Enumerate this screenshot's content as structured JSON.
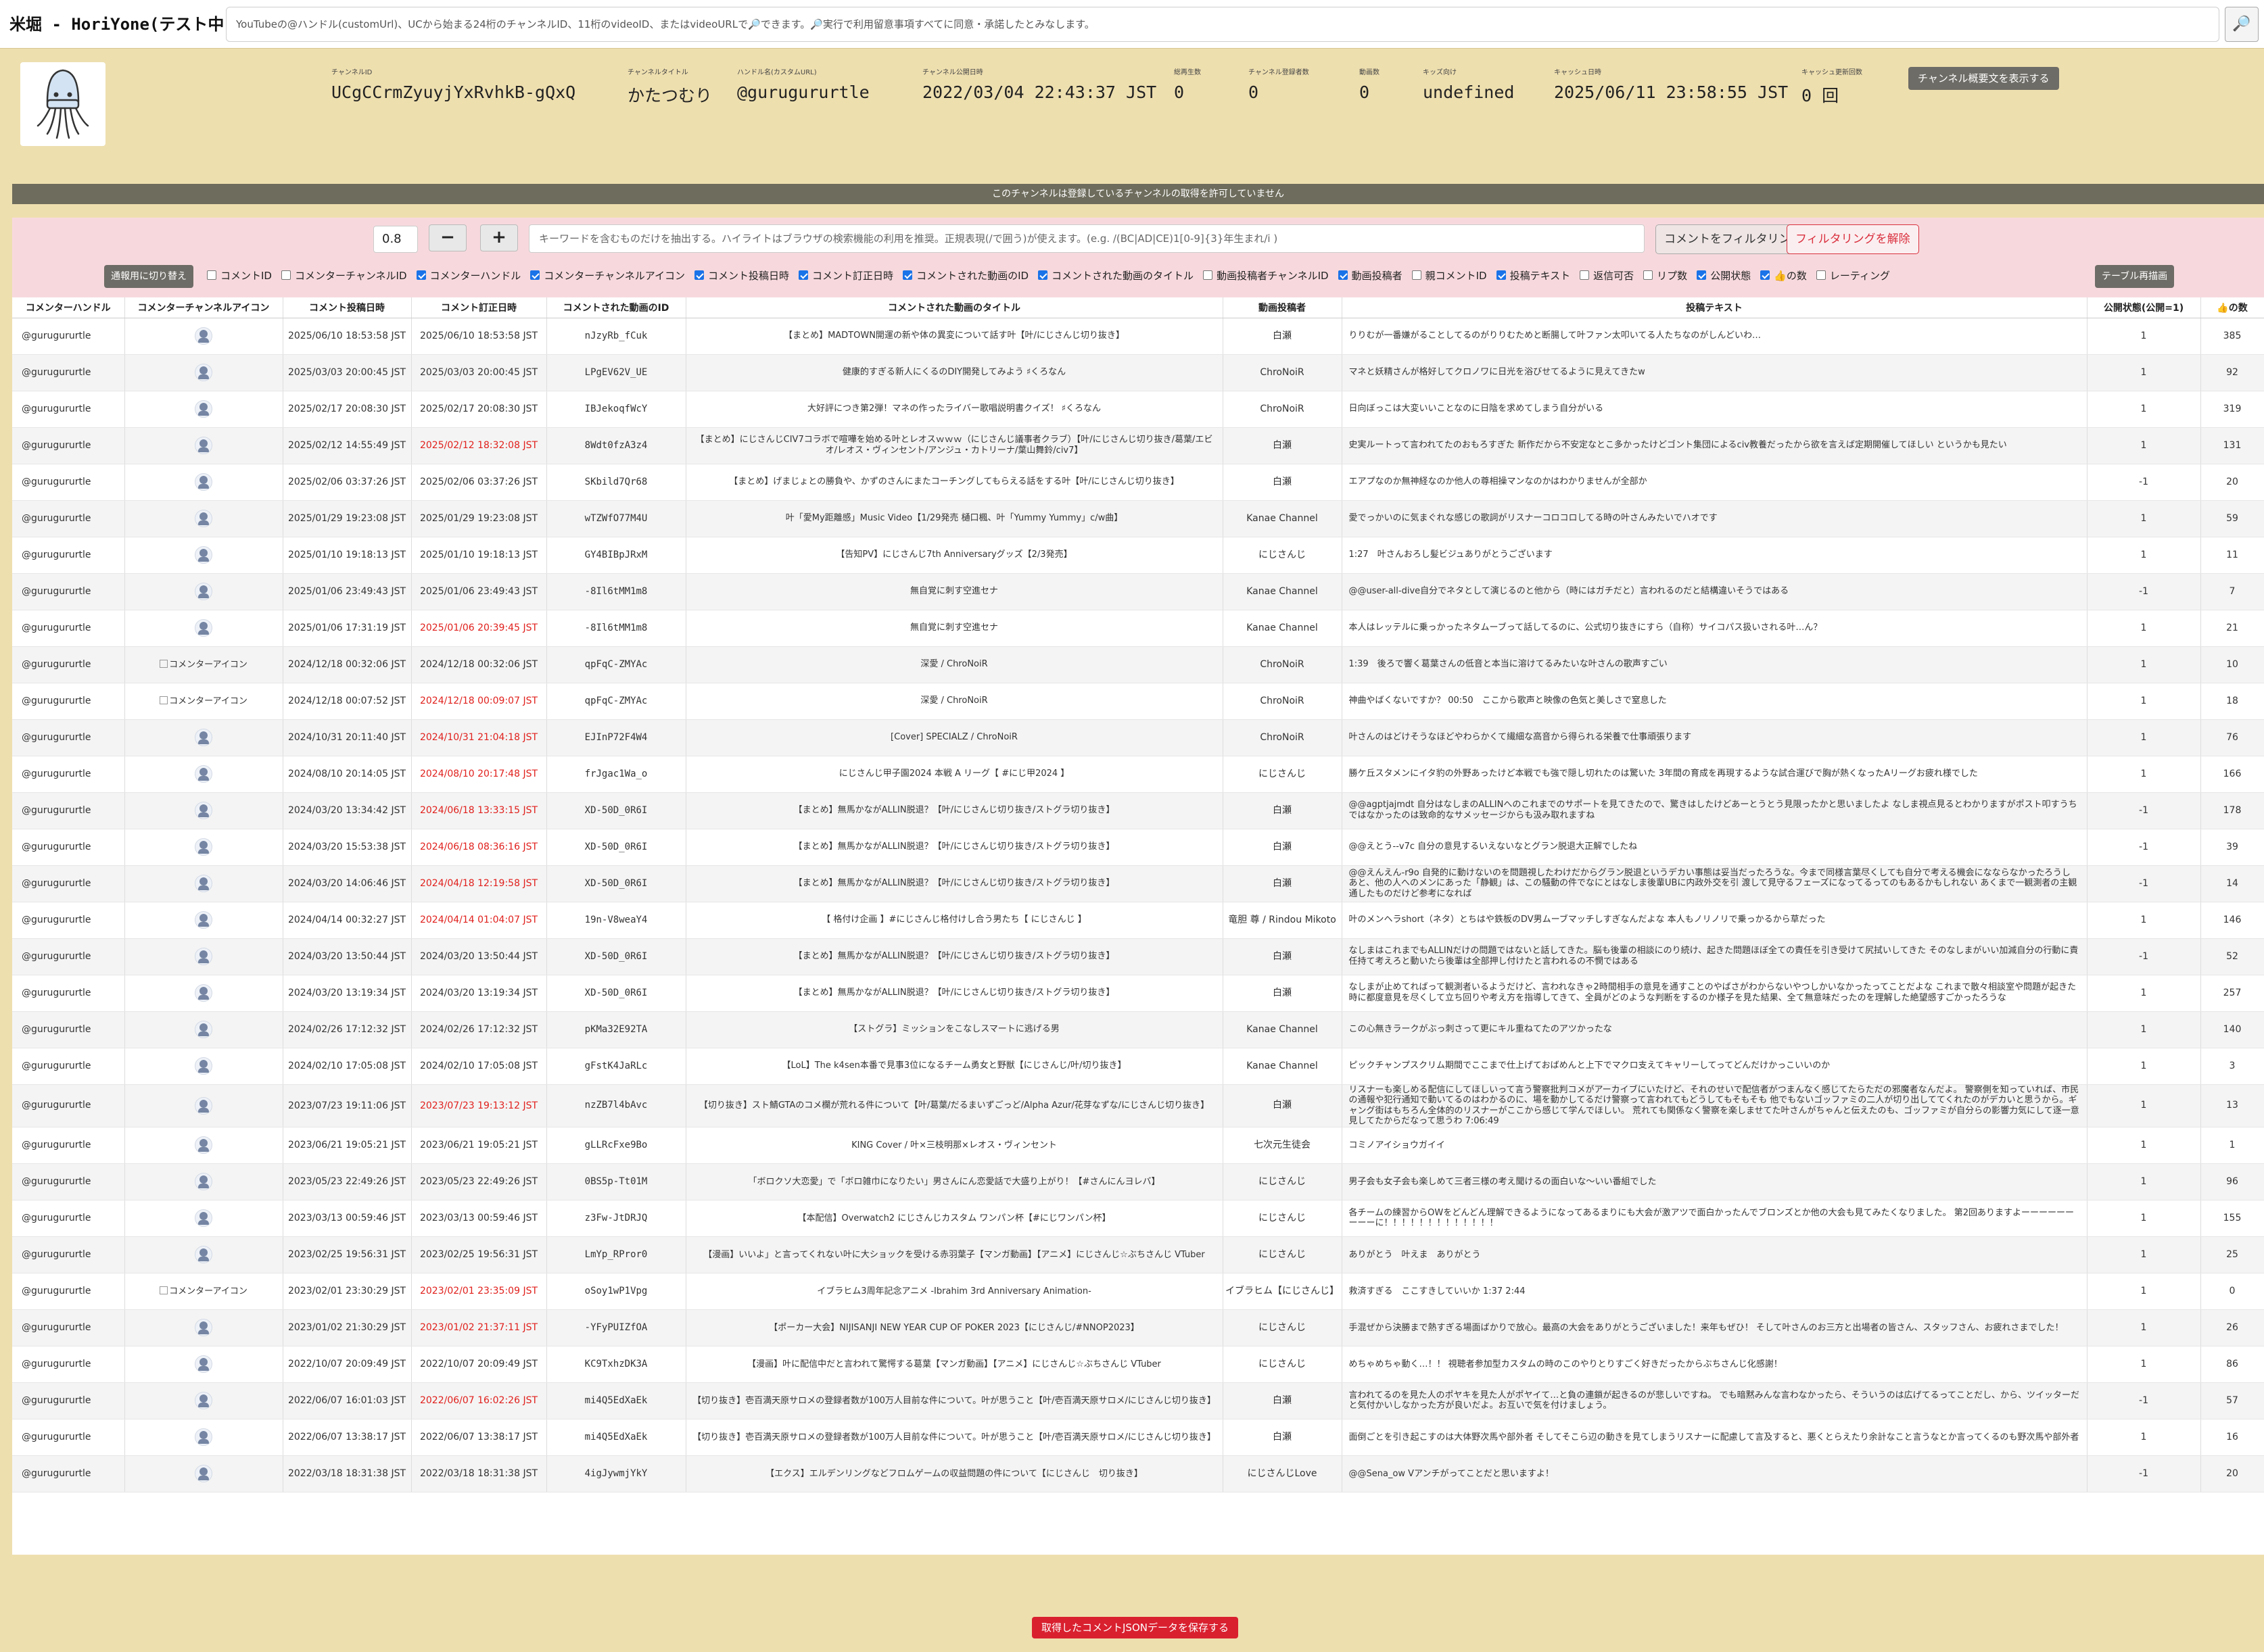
{
  "app": {
    "title": "米堀 - HoriYone(テスト中)",
    "search_placeholder": "YouTubeの@ハンドル(customUrl)、UCから始まる24桁のチャンネルID、11桁のvideoID、またはvideoURLで🔎できます。🔎実行で利用留意事項すべてに同意・承諾したとみなします。",
    "search_icon": "🔎"
  },
  "channel": {
    "fields": [
      {
        "label": "チャンネルID",
        "value": "UCgCCrmZyuyjYxRvhkB-gQxQ"
      },
      {
        "label": "チャンネルタイトル",
        "value": "かたつむり"
      },
      {
        "label": "ハンドル名(カスタムURL)",
        "value": "@gurugururtle"
      },
      {
        "label": "チャンネル公開日時",
        "value": "2022/03/04 22:43:37 JST"
      },
      {
        "label": "総再生数",
        "value": "0"
      },
      {
        "label": "チャンネル登録者数",
        "value": "0"
      },
      {
        "label": "動画数",
        "value": "0"
      },
      {
        "label": "キッズ向け",
        "value": "undefined"
      },
      {
        "label": "キャッシュ日時",
        "value": "2025/06/11 23:58:55 JST"
      },
      {
        "label": "キャッシュ更新回数",
        "value": "0 回"
      }
    ],
    "show_desc_label": "チャンネル概要文を表示する"
  },
  "notice": "このチャンネルは登録しているチャンネルの取得を許可していません",
  "filter": {
    "threshold": "0.8",
    "minus": "−",
    "plus": "+",
    "keyword_placeholder": "キーワードを含むものだけを抽出する。ハイライトはブラウザの検索機能の利用を推奨。正規表現(/で囲う)が使えます。(e.g. /(BC|AD|CE)1[0-9]{3}年生まれ/i )",
    "apply_label": "コメントをフィルタリング",
    "clear_label": "フィルタリングを解除"
  },
  "toggle_label": "通報用に切り替え",
  "redraw_label": "テーブル再描画",
  "columns_toggle": [
    {
      "label": "コメントID",
      "checked": false
    },
    {
      "label": "コメンターチャンネルID",
      "checked": false
    },
    {
      "label": "コメンターハンドル",
      "checked": true
    },
    {
      "label": "コメンターチャンネルアイコン",
      "checked": true
    },
    {
      "label": "コメント投稿日時",
      "checked": true
    },
    {
      "label": "コメント訂正日時",
      "checked": true
    },
    {
      "label": "コメントされた動画のID",
      "checked": true
    },
    {
      "label": "コメントされた動画のタイトル",
      "checked": true
    },
    {
      "label": "動画投稿者チャンネルID",
      "checked": false
    },
    {
      "label": "動画投稿者",
      "checked": true
    },
    {
      "label": "親コメントID",
      "checked": false
    },
    {
      "label": "投稿テキスト",
      "checked": true
    },
    {
      "label": "返信可否",
      "checked": false
    },
    {
      "label": "リプ数",
      "checked": false
    },
    {
      "label": "公開状態",
      "checked": true
    },
    {
      "label": "👍の数",
      "checked": true
    },
    {
      "label": "レーティング",
      "checked": false
    }
  ],
  "table": {
    "headers": [
      "コメンターハンドル",
      "コメンターチャンネルアイコン",
      "コメント投稿日時",
      "コメント訂正日時",
      "コメントされた動画のID",
      "コメントされた動画のタイトル",
      "動画投稿者",
      "投稿テキスト",
      "公開状態(公開=1)",
      "👍の数"
    ],
    "icon_alt": "コメンターアイコン",
    "rows": [
      {
        "handle": "@gurugururtle",
        "icon": "avatar",
        "posted": "2025/06/10 18:53:58 JST",
        "edited": "2025/06/10 18:53:58 JST",
        "edited_diff": false,
        "video_id": "nJzyRb_fCuk",
        "title": "【まとめ】MADTOWN開運の新や体の異変について話す叶【叶/にじさんじ切り抜き】",
        "uploader": "白瀬",
        "text": "りりむが一番嫌がることしてるのがりりむためと断腸して叶ファン太叩いてる人たちなのがしんどいわ…",
        "status": "1",
        "likes": "385"
      },
      {
        "handle": "@gurugururtle",
        "icon": "avatar",
        "posted": "2025/03/03 20:00:45 JST",
        "edited": "2025/03/03 20:00:45 JST",
        "edited_diff": false,
        "video_id": "LPgEV62V_UE",
        "title": "健康的すぎる新人にくるのDIY開発してみよう ♯くろなん",
        "uploader": "ChroNoiR",
        "text": "マネと妖精さんが格好してクロノワに日光を浴びせてるように見えてきたw",
        "status": "1",
        "likes": "92"
      },
      {
        "handle": "@gurugururtle",
        "icon": "avatar",
        "posted": "2025/02/17 20:08:30 JST",
        "edited": "2025/02/17 20:08:30 JST",
        "edited_diff": false,
        "video_id": "IBJekoqfWcY",
        "title": "大好評につき第2弾！マネの作ったライバー歌唱説明書クイズ！ ♯くろなん",
        "uploader": "ChroNoiR",
        "text": "日向ぼっこは大変いいことなのに日陰を求めてしまう自分がいる",
        "status": "1",
        "likes": "319"
      },
      {
        "handle": "@gurugururtle",
        "icon": "avatar",
        "posted": "2025/02/12 14:55:49 JST",
        "edited": "2025/02/12 18:32:08 JST",
        "edited_diff": true,
        "video_id": "8Wdt0fzA3z4",
        "title": "【まとめ】にじさんじCIV7コラボで喧嘩を始める叶とレオスｗｗｗ（にじさんじ議事者クラブ）【叶/にじさんじ切り抜き/葛葉/エビオ/レオス・ヴィンセント/アンジュ・カトリーナ/葉山舞鈴/civ7】",
        "uploader": "白瀬",
        "text": "史実ルートって言われてたのおもろすぎた 新作だから不安定なとこ多かったけどゴント集団によるciv教養だったから欲を言えば定期開催してほしい というかも見たい",
        "status": "1",
        "likes": "131"
      },
      {
        "handle": "@gurugururtle",
        "icon": "avatar",
        "posted": "2025/02/06 03:37:26 JST",
        "edited": "2025/02/06 03:37:26 JST",
        "edited_diff": false,
        "video_id": "SKbild7Qr68",
        "title": "【まとめ】げまじょとの勝負や、かずのさんにまたコーチングしてもらえる話をする叶【叶/にじさんじ切り抜き】",
        "uploader": "白瀬",
        "text": "エアプなのか無神経なのか他人の尊相操マンなのかはわかりませんが全部か",
        "status": "-1",
        "likes": "20"
      },
      {
        "handle": "@gurugururtle",
        "icon": "avatar",
        "posted": "2025/01/29 19:23:08 JST",
        "edited": "2025/01/29 19:23:08 JST",
        "edited_diff": false,
        "video_id": "wTZWfO77M4U",
        "title": "叶「愛My距離感」Music Video【1/29発売 樋口楓、叶「Yummy Yummy」c/w曲】",
        "uploader": "Kanae Channel",
        "text": "愛でっかいのに気まぐれな感じの歌詞がリスナーコロコロしてる時の叶さんみたいでハオです",
        "status": "1",
        "likes": "59"
      },
      {
        "handle": "@gurugururtle",
        "icon": "avatar",
        "posted": "2025/01/10 19:18:13 JST",
        "edited": "2025/01/10 19:18:13 JST",
        "edited_diff": false,
        "video_id": "GY4BIBpJRxM",
        "title": "【告知PV】にじさんじ7th Anniversaryグッズ【2/3発売】",
        "uploader": "にじさんじ",
        "text": "1:27　叶さんおろし髪ビジュありがとうございます",
        "status": "1",
        "likes": "11"
      },
      {
        "handle": "@gurugururtle",
        "icon": "avatar",
        "posted": "2025/01/06 23:49:43 JST",
        "edited": "2025/01/06 23:49:43 JST",
        "edited_diff": false,
        "video_id": "-8Il6tMM1m8",
        "title": "無自覚に刺す空進セナ",
        "uploader": "Kanae Channel",
        "text": "@@user-all-dive自分でネタとして演じるのと他から（時にはガチだと）言われるのだと結構違いそうではある",
        "status": "-1",
        "likes": "7"
      },
      {
        "handle": "@gurugururtle",
        "icon": "avatar",
        "posted": "2025/01/06 17:31:19 JST",
        "edited": "2025/01/06 20:39:45 JST",
        "edited_diff": true,
        "video_id": "-8Il6tMM1m8",
        "title": "無自覚に刺す空進セナ",
        "uploader": "Kanae Channel",
        "text": "本人はレッテルに乗っかったネタムーブって話してるのに、公式切り抜きにすら（自称）サイコパス扱いされる叶…ん？",
        "status": "1",
        "likes": "21"
      },
      {
        "handle": "@gurugururtle",
        "icon": "broken",
        "posted": "2024/12/18 00:32:06 JST",
        "edited": "2024/12/18 00:32:06 JST",
        "edited_diff": false,
        "video_id": "qpFqC-ZMYAc",
        "title": "深愛 / ChroNoiR",
        "uploader": "ChroNoiR",
        "text": "1:39　後ろで響く葛葉さんの低音と本当に溶けてるみたいな叶さんの歌声すごい",
        "status": "1",
        "likes": "10"
      },
      {
        "handle": "@gurugururtle",
        "icon": "broken",
        "posted": "2024/12/18 00:07:52 JST",
        "edited": "2024/12/18 00:09:07 JST",
        "edited_diff": true,
        "video_id": "qpFqC-ZMYAc",
        "title": "深愛 / ChroNoiR",
        "uploader": "ChroNoiR",
        "text": "神曲やばくないですか？ 00:50　ここから歌声と映像の色気と美しさで窒息した",
        "status": "1",
        "likes": "18"
      },
      {
        "handle": "@gurugururtle",
        "icon": "avatar",
        "posted": "2024/10/31 20:11:40 JST",
        "edited": "2024/10/31 21:04:18 JST",
        "edited_diff": true,
        "video_id": "EJInP72F4W4",
        "title": "[Cover] SPECIALZ / ChroNoiR",
        "uploader": "ChroNoiR",
        "text": "叶さんのはどけそうなほどやわらかくて繊細な高音から得られる栄養で仕事頑張ります",
        "status": "1",
        "likes": "76"
      },
      {
        "handle": "@gurugururtle",
        "icon": "avatar",
        "posted": "2024/08/10 20:14:05 JST",
        "edited": "2024/08/10 20:17:48 JST",
        "edited_diff": true,
        "video_id": "frJgac1Wa_o",
        "title": "にじさんじ甲子園2024 本戦 A リーグ【 #にじ甲2024 】",
        "uploader": "にじさんじ",
        "text": "勝ケ丘スタメンにイタ豹の外野あったけど本戦でも強で隠し切れたのは驚いた 3年間の育成を再現するような試合運びで胸が熱くなったAリーグお疲れ様でした",
        "status": "1",
        "likes": "166"
      },
      {
        "handle": "@gurugururtle",
        "icon": "avatar",
        "posted": "2024/03/20 13:34:42 JST",
        "edited": "2024/06/18 13:33:15 JST",
        "edited_diff": true,
        "video_id": "XD-50D_0R6I",
        "title": "【まとめ】無馬かながALLIN脱退？【叶/にじさんじ切り抜き/ストグラ切り抜き】",
        "uploader": "白瀬",
        "text": "@@agptjajmdt 自分はなしまのALLINへのこれまでのサポートを見てきたので、驚きはしたけどあーとうとう見限ったかと思いましたよ なしま視点見るとわかりますがポスト叩すうちではなかったのは致命的なサメッセージからも汲み取れますね",
        "status": "-1",
        "likes": "178"
      },
      {
        "handle": "@gurugururtle",
        "icon": "avatar",
        "posted": "2024/03/20 15:53:38 JST",
        "edited": "2024/06/18 08:36:16 JST",
        "edited_diff": true,
        "video_id": "XD-50D_0R6I",
        "title": "【まとめ】無馬かながALLIN脱退？【叶/にじさんじ切り抜き/ストグラ切り抜き】",
        "uploader": "白瀬",
        "text": "@@えとう--v7c 自分の意見するいえないなとグラン脱退大正解でしたね",
        "status": "-1",
        "likes": "39"
      },
      {
        "handle": "@gurugururtle",
        "icon": "avatar",
        "posted": "2024/03/20 14:06:46 JST",
        "edited": "2024/04/18 12:19:58 JST",
        "edited_diff": true,
        "video_id": "XD-50D_0R6I",
        "title": "【まとめ】無馬かながALLIN脱退？【叶/にじさんじ切り抜き/ストグラ切り抜き】",
        "uploader": "白瀬",
        "text": "@@えんえん-r9o 自発的に動けないのを問題視したわけだからグラン脱退というデカい事態は妥当だったろうな。今まで同様言葉尽くしても自分で考える機会になならなかったろうし あと、他の人へのメンにあった「静観」は、この騒動の件でなにとはなしま後輩UBに内政外交を引 渡して見守るフェーズになってるってのもあるかもしれない あくまで一観測者の主観通したものだけど参考になれば",
        "status": "-1",
        "likes": "14"
      },
      {
        "handle": "@gurugururtle",
        "icon": "avatar",
        "posted": "2024/04/14 00:32:27 JST",
        "edited": "2024/04/14 01:04:07 JST",
        "edited_diff": true,
        "video_id": "19n-V8weaY4",
        "title": "【 格付け企画 】#にじさんじ格付けし合う男たち【 にじさんじ 】",
        "uploader": "竜胆 尊 / Rindou Mikoto",
        "text": "叶のメンヘラshort（ネタ）とちはや鉄板のDV男ムーブマッチしすぎなんだよな 本人もノリノリで乗っかるから草だった",
        "status": "1",
        "likes": "146"
      },
      {
        "handle": "@gurugururtle",
        "icon": "avatar",
        "posted": "2024/03/20 13:50:44 JST",
        "edited": "2024/03/20 13:50:44 JST",
        "edited_diff": false,
        "video_id": "XD-50D_0R6I",
        "title": "【まとめ】無馬かながALLIN脱退？【叶/にじさんじ切り抜き/ストグラ切り抜き】",
        "uploader": "白瀬",
        "text": "なしまはこれまでもALLINだけの問題ではないと話してきた。脳も後輩の相談にのり続け、起きた問題ほぼ全ての責任を引き受けて尻拭いしてきた そのなしまがいい加減自分の行動に責任持て考えろと動いたら後輩は全部押し付けたと言われるの不憫ではある",
        "status": "-1",
        "likes": "52"
      },
      {
        "handle": "@gurugururtle",
        "icon": "avatar",
        "posted": "2024/03/20 13:19:34 JST",
        "edited": "2024/03/20 13:19:34 JST",
        "edited_diff": false,
        "video_id": "XD-50D_0R6I",
        "title": "【まとめ】無馬かながALLIN脱退？【叶/にじさんじ切り抜き/ストグラ切り抜き】",
        "uploader": "白瀬",
        "text": "なしまが止めてればって観測者いるようだけど、言われなきゃ2時間相手の意見を通すことのやばさがわからないやつしかいなかったってことだよな これまで散々相談室や問題が起きた時に都度意見を尽くして立ち回りや考え方を指導してきて、全員がどのような判断をするのか様子を見た結果、全て無意味だったのを理解した絶望感すごかったろうな",
        "status": "1",
        "likes": "257"
      },
      {
        "handle": "@gurugururtle",
        "icon": "avatar",
        "posted": "2024/02/26 17:12:32 JST",
        "edited": "2024/02/26 17:12:32 JST",
        "edited_diff": false,
        "video_id": "pKMa32E92TA",
        "title": "【ストグラ】ミッションをこなしスマートに逃げる男",
        "uploader": "Kanae Channel",
        "text": "この心無きラークがぶっ刺さって更にキル重ねてたのアツかったな",
        "status": "1",
        "likes": "140"
      },
      {
        "handle": "@gurugururtle",
        "icon": "avatar",
        "posted": "2024/02/10 17:05:08 JST",
        "edited": "2024/02/10 17:05:08 JST",
        "edited_diff": false,
        "video_id": "gFstK4JaRLc",
        "title": "【LoL】The k4sen本番で見事3位になるチーム勇女と野獣【にじさんじ/叶/切り抜き】",
        "uploader": "Kanae Channel",
        "text": "ピックチャンプスクリム期間でここまで仕上げておばめんと上下でマクロ支えてキャリーしてってどんだけかっこいいのか",
        "status": "1",
        "likes": "3"
      },
      {
        "handle": "@gurugururtle",
        "icon": "avatar",
        "posted": "2023/07/23 19:11:06 JST",
        "edited": "2023/07/23 19:13:12 JST",
        "edited_diff": true,
        "video_id": "nzZB7l4bAvc",
        "title": "【切り抜き】スト鯖GTAのコメ欄が荒れる件について【叶/葛葉/だるまいずごっど/Alpha Azur/花芽なずな/にじさんじ切り抜き】",
        "uploader": "白瀬",
        "text": "リスナーも楽しめる配信にしてほしいって言う警察批判コメがアーカイブにいたけど、それのせいで配信者がつまんなく感じてたらただの邪魔者なんだよ。 警察側を知っていれば、市民の通報や犯行通知で動いてるのはわかるのに、場を動かしてるだけ警察って言われてもどうしてもそもそも 他でもないゴッファミの二人が切り出しててくれたのがデカいと思うから。ギャング街はもちろん全体的のリスナーがここから感じて学んでほしい。 荒れても関係なく警察を楽しませてた叶さんがちゃんと伝えたのも、ゴッファミが自分らの影響力気にして逐一意見してたからだなって思うわ 7:06:49",
        "status": "1",
        "likes": "13"
      },
      {
        "handle": "@gurugururtle",
        "icon": "avatar",
        "posted": "2023/06/21 19:05:21 JST",
        "edited": "2023/06/21 19:05:21 JST",
        "edited_diff": false,
        "video_id": "gLLRcFxe9Bo",
        "title": "KING Cover / 叶×三枝明那×レオス・ヴィンセント",
        "uploader": "七次元生徒会",
        "text": "コミノアイショウガイイ",
        "status": "1",
        "likes": "1"
      },
      {
        "handle": "@gurugururtle",
        "icon": "avatar",
        "posted": "2023/05/23 22:49:26 JST",
        "edited": "2023/05/23 22:49:26 JST",
        "edited_diff": false,
        "video_id": "0BS5p-Tt01M",
        "title": "「ボロクソ大恋愛」で「ボロ雑巾になりたい」男さんにん恋愛話で大盛り上がり！【#さんにんヨレバ】",
        "uploader": "にじさんじ",
        "text": "男子会も女子会も楽しめて三者三様の考え聞けるの面白いな～いい番組でした",
        "status": "1",
        "likes": "96"
      },
      {
        "handle": "@gurugururtle",
        "icon": "avatar",
        "posted": "2023/03/13 00:59:46 JST",
        "edited": "2023/03/13 00:59:46 JST",
        "edited_diff": false,
        "video_id": "z3Fw-JtDRJQ",
        "title": "【本配信】Overwatch2 にじさんじカスタム ワンパン杯【#にじワンパン杯】",
        "uploader": "にじさんじ",
        "text": "各チームの練習からOWをどんどん理解できるようになってあるまりにも大会が激アツで面白かったんでブロンズとか他の大会も見てみたくなりました。 第2回ありますよーーーーーーーーーに！！！！！！！！！！！！！",
        "status": "1",
        "likes": "155"
      },
      {
        "handle": "@gurugururtle",
        "icon": "avatar",
        "posted": "2023/02/25 19:56:31 JST",
        "edited": "2023/02/25 19:56:31 JST",
        "edited_diff": false,
        "video_id": "LmYp_RPror0",
        "title": "【漫画】いいよ」と言ってくれない叶に大ショックを受ける赤羽葉子【マンガ動画】【アニメ】にじさんじ☆ぶちさんじ VTuber",
        "uploader": "にじさんじ",
        "text": "ありがとう　叶えま　ありがとう",
        "status": "1",
        "likes": "25"
      },
      {
        "handle": "@gurugururtle",
        "icon": "broken",
        "posted": "2023/02/01 23:30:29 JST",
        "edited": "2023/02/01 23:35:09 JST",
        "edited_diff": true,
        "video_id": "oSoy1wP1Vpg",
        "title": "イブラヒム3周年記念アニメ -Ibrahim 3rd Anniversary Animation-",
        "uploader": "イブラヒム【にじさんじ】",
        "text": "救済すぎる　ここすきしていいか 1:37 2:44",
        "status": "1",
        "likes": "0"
      },
      {
        "handle": "@gurugururtle",
        "icon": "avatar",
        "posted": "2023/01/02 21:30:29 JST",
        "edited": "2023/01/02 21:37:11 JST",
        "edited_diff": true,
        "video_id": "-YFyPUIZfOA",
        "title": "【ポーカー大会】NIJISANJI NEW YEAR CUP OF POKER 2023【にじさんじ/#NNOP2023】",
        "uploader": "にじさんじ",
        "text": "手混ぜから決勝まで熱すぎる場面ばかりで放心。最高の大会をありがとうございました！来年もぜひ！ そして叶さんのお三方と出場者の皆さん、スタッフさん、お疲れさまでした！",
        "status": "1",
        "likes": "26"
      },
      {
        "handle": "@gurugururtle",
        "icon": "avatar",
        "posted": "2022/10/07 20:09:49 JST",
        "edited": "2022/10/07 20:09:49 JST",
        "edited_diff": false,
        "video_id": "KC9TxhzDK3A",
        "title": "【漫画】叶に配信中だと言われて驚愕する葛葉【マンガ動画】【アニメ】にじさんじ☆ぶちさんじ VTuber",
        "uploader": "にじさんじ",
        "text": "めちゃめちゃ動く…！！ 視聴者参加型カスタムの時のこのやりとりすごく好きだったからぶちさんじ化感謝！",
        "status": "1",
        "likes": "86"
      },
      {
        "handle": "@gurugururtle",
        "icon": "avatar",
        "posted": "2022/06/07 16:01:03 JST",
        "edited": "2022/06/07 16:02:26 JST",
        "edited_diff": true,
        "video_id": "mi4Q5EdXaEk",
        "title": "【切り抜き】壱百満天原サロメの登録者数が100万人目前な件について。叶が思うこと【叶/壱百満天原サロメ/にじさんじ切り抜き】",
        "uploader": "白瀬",
        "text": "言われてるのを見た人のポヤキを見た人がポヤイて…と負の連鎖が起きるのが悲しいですね。 でも暗黙みんな言わなかったら、そういうのは広げてるってことだし、から、ツイッターだと気付かいしなかった方が良いだよ。お互いで気を付けましょう。",
        "status": "-1",
        "likes": "57"
      },
      {
        "handle": "@gurugururtle",
        "icon": "avatar",
        "posted": "2022/06/07 13:38:17 JST",
        "edited": "2022/06/07 13:38:17 JST",
        "edited_diff": false,
        "video_id": "mi4Q5EdXaEk",
        "title": "【切り抜き】壱百満天原サロメの登録者数が100万人目前な件について。叶が思うこと【叶/壱百満天原サロメ/にじさんじ切り抜き】",
        "uploader": "白瀬",
        "text": "面倒ごとを引き起こすのは大体野次馬や部外者 そしてそこら辺の動きを見てしまうリスナーに配慮して言及すると、悪くとらえたり余計なこと言うなとか言ってくるのも野次馬や部外者",
        "status": "1",
        "likes": "16"
      },
      {
        "handle": "@gurugururtle",
        "icon": "avatar",
        "posted": "2022/03/18 18:31:38 JST",
        "edited": "2022/03/18 18:31:38 JST",
        "edited_diff": false,
        "video_id": "4igJywmjYkY",
        "title": "【エクス】エルデンリングなどフロムゲームの収益問題の件について【にじさんじ　切り抜き】",
        "uploader": "にじさんじLove",
        "text": "@@Sena_ow Vアンチがってことだと思いますよ！",
        "status": "-1",
        "likes": "20"
      }
    ]
  },
  "save_label": "取得したコメントJSONデータを保存する"
}
